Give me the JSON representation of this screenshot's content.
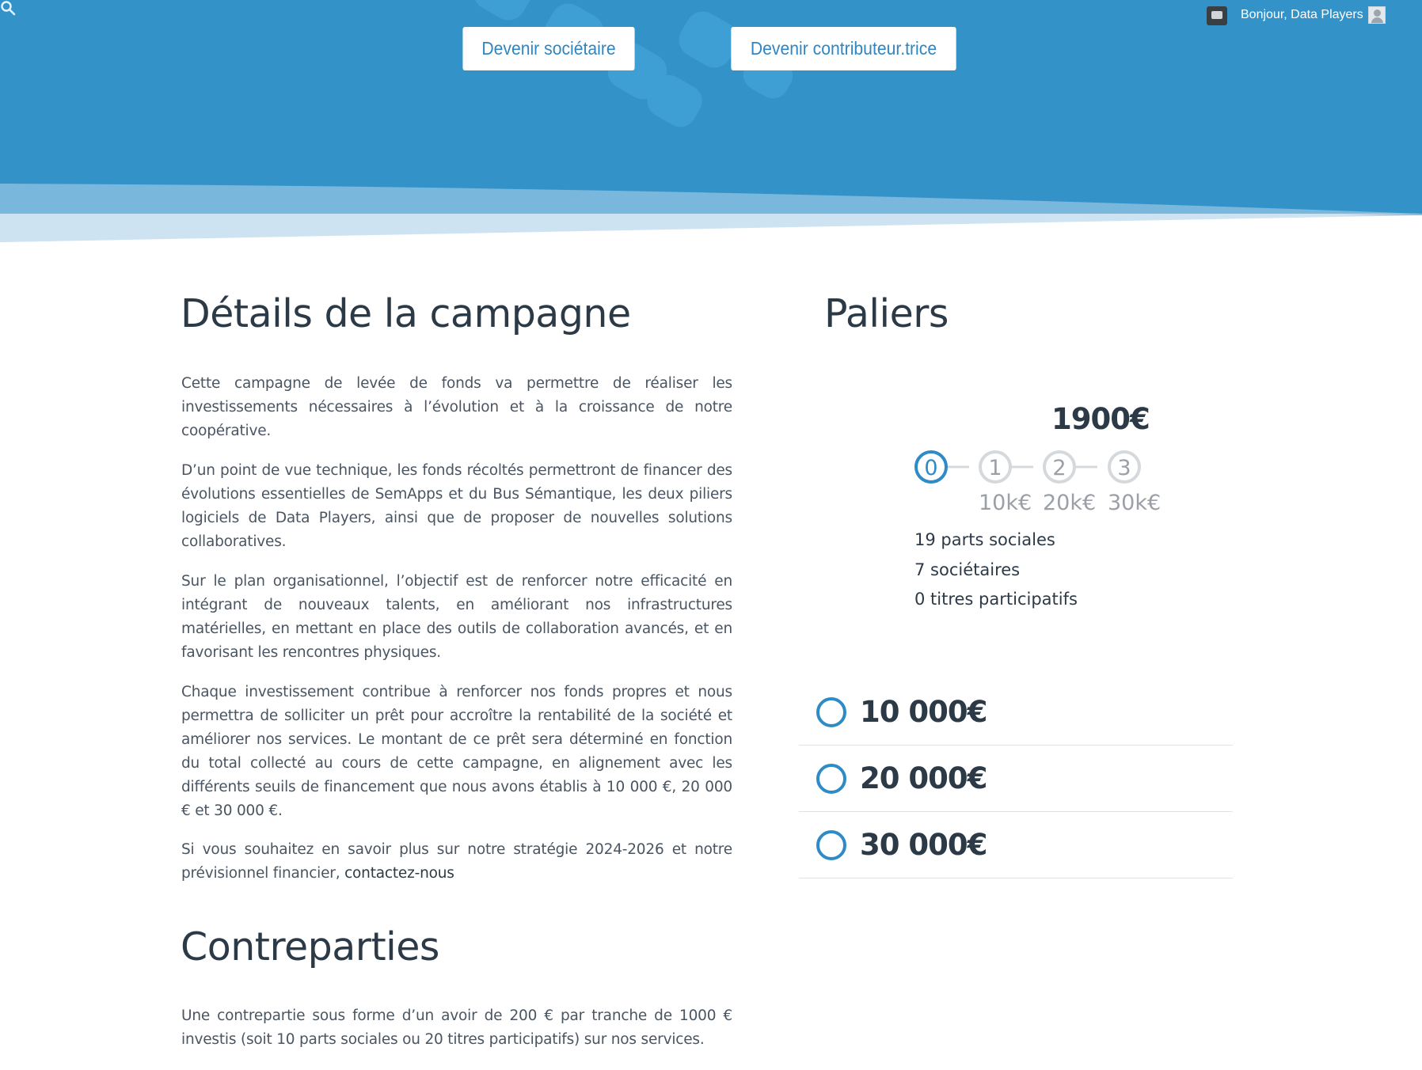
{
  "header": {
    "buttons": {
      "societaire": "Devenir sociétaire",
      "contributeur": "Devenir contributeur.trice"
    },
    "greeting": "Bonjour, Data Players"
  },
  "details": {
    "title": "Détails de la campagne",
    "paragraphs": [
      "Cette campagne de levée de fonds va permettre de réaliser les investissements nécessaires à l’évolution et à la croissance de notre coopérative.",
      "D’un point de vue technique, les fonds récoltés permettront de financer des évolutions essentielles de SemApps et du Bus Sémantique, les deux piliers logiciels de Data Players, ainsi que de proposer de nouvelles solutions collaboratives.",
      "Sur le plan organisationnel, l’objectif est de renforcer notre efficacité en intégrant de nouveaux talents, en améliorant nos infrastructures matérielles, en mettant en place des outils de collaboration avancés, et en favorisant les rencontres physiques.",
      "Chaque investissement contribue à renforcer nos fonds propres et nous permettra de solliciter un prêt pour accroître la rentabilité de la société et améliorer nos services. Le montant de ce prêt sera déterminé en fonction du total collecté au cours de cette campagne, en alignement avec les différents seuils de financement que nous avons établis à 10 000 €, 20 000 € et 30 000 €.",
      "Si vous souhaitez en savoir plus sur notre stratégie 2024-2026 et notre prévisionnel financier,"
    ],
    "contact_link": "contactez-nous"
  },
  "contreparties": {
    "title": "Contreparties",
    "text": "Une contrepartie sous forme d’un avoir de 200 € par tranche de 1000 € investis (soit 10 parts sociales ou 20 titres participatifs) sur nos services."
  },
  "paliers": {
    "title": "Paliers",
    "amount": "1900€",
    "current_step": 0,
    "steps": [
      "0",
      "1",
      "2",
      "3"
    ],
    "step_labels": [
      "10k€",
      "20k€",
      "30k€"
    ],
    "stats": [
      "19 parts sociales",
      "7 sociétaires",
      "0 titres participatifs"
    ],
    "tiers": [
      "10 000€",
      "20 000€",
      "30 000€"
    ],
    "colors": {
      "active": "#2f8bc6",
      "inactive": "#d6d9dc",
      "hero": "#3393c9"
    }
  }
}
